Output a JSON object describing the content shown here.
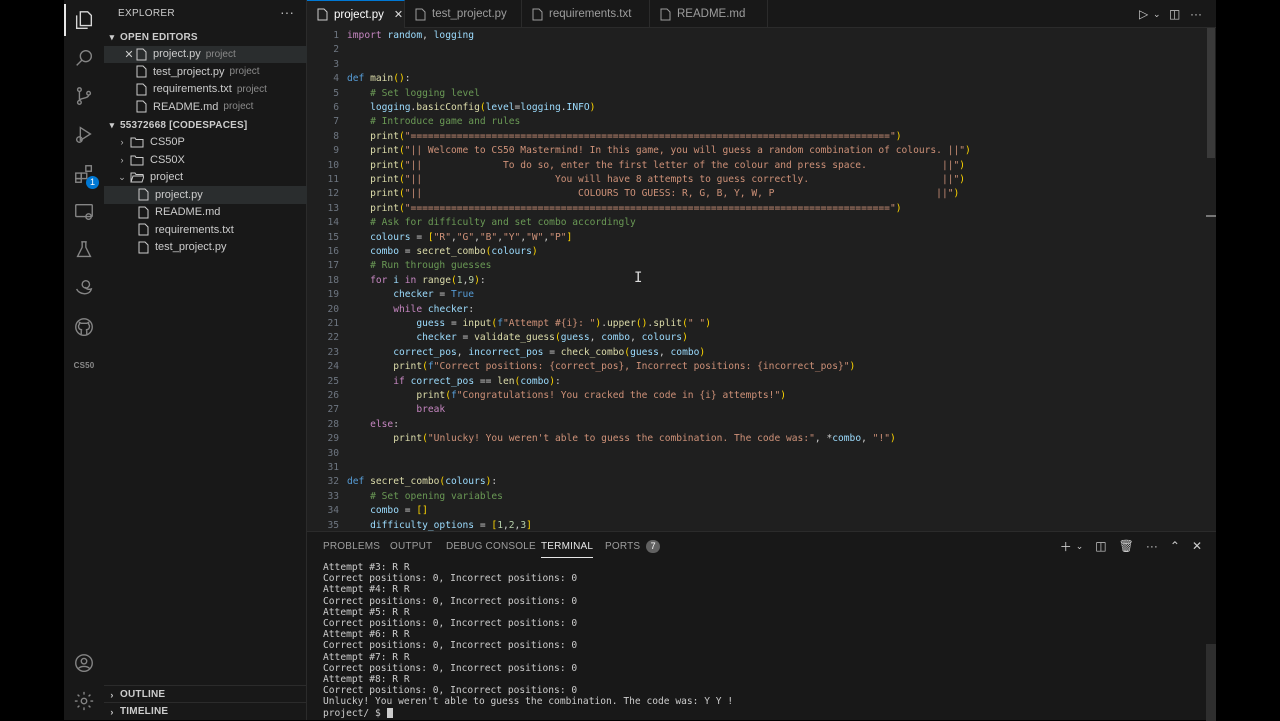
{
  "activity_bar": {
    "extensions_badge": "1",
    "cs50_label": "CS50"
  },
  "explorer": {
    "title": "EXPLORER",
    "open_editors_label": "OPEN EDITORS",
    "open_editors": [
      {
        "name": "project.py",
        "desc": "project"
      },
      {
        "name": "test_project.py",
        "desc": "project"
      },
      {
        "name": "requirements.txt",
        "desc": "project"
      },
      {
        "name": "README.md",
        "desc": "project"
      }
    ],
    "workspace_label": "55372668 [CODESPACES]",
    "folders": [
      "CS50P",
      "CS50X",
      "project"
    ],
    "project_files": [
      "project.py",
      "README.md",
      "requirements.txt",
      "test_project.py"
    ],
    "outline_label": "OUTLINE",
    "timeline_label": "TIMELINE"
  },
  "tabs": [
    {
      "label": "project.py"
    },
    {
      "label": "test_project.py"
    },
    {
      "label": "requirements.txt"
    },
    {
      "label": "README.md"
    }
  ],
  "editor": {
    "line_numbers": [
      "1",
      "2",
      "3",
      "4",
      "5",
      "6",
      "7",
      "8",
      "9",
      "10",
      "11",
      "12",
      "13",
      "14",
      "15",
      "16",
      "17",
      "18",
      "19",
      "20",
      "21",
      "22",
      "23",
      "24",
      "25",
      "26",
      "27",
      "28",
      "29",
      "30",
      "31",
      "32",
      "33",
      "34",
      "35"
    ],
    "code_lines": [
      "import random, logging",
      "",
      "",
      "def main():",
      "    # Set logging level",
      "    logging.basicConfig(level=logging.INFO)",
      "    # Introduce game and rules",
      "    print(\"===================================================================================\")",
      "    print(\"|| Welcome to CS50 Mastermind! In this game, you will guess a random combination of colours. ||\")",
      "    print(\"||              To do so, enter the first letter of the colour and press space.             ||\")",
      "    print(\"||                       You will have 8 attempts to guess correctly.                       ||\")",
      "    print(\"||                           COLOURS TO GUESS: R, G, B, Y, W, P                            ||\")",
      "    print(\"===================================================================================\")",
      "    # Ask for difficulty and set combo accordingly",
      "    colours = [\"R\",\"G\",\"B\",\"Y\",\"W\",\"P\"]",
      "    combo = secret_combo(colours)",
      "    # Run through guesses",
      "    for i in range(1,9):",
      "        checker = True",
      "        while checker:",
      "            guess = input(f\"Attempt #{i}: \").upper().split(\" \")",
      "            checker = validate_guess(guess, combo, colours)",
      "        correct_pos, incorrect_pos = check_combo(guess, combo)",
      "        print(f\"Correct positions: {correct_pos}, Incorrect positions: {incorrect_pos}\")",
      "        if correct_pos == len(combo):",
      "            print(f\"Congratulations! You cracked the code in {i} attempts!\")",
      "            break",
      "    else:",
      "        print(\"Unlucky! You weren't able to guess the combination. The code was:\", *combo, \"!\")",
      "",
      "",
      "def secret_combo(colours):",
      "    # Set opening variables",
      "    combo = []",
      "    difficulty_options = [1,2,3]"
    ]
  },
  "panel": {
    "tabs": [
      "PROBLEMS",
      "OUTPUT",
      "DEBUG CONSOLE",
      "TERMINAL",
      "PORTS"
    ],
    "ports_badge": "7",
    "terminal_lines": [
      "Attempt #3: R R",
      "Correct positions: 0, Incorrect positions: 0",
      "Attempt #4: R R",
      "Correct positions: 0, Incorrect positions: 0",
      "Attempt #5: R R",
      "Correct positions: 0, Incorrect positions: 0",
      "Attempt #6: R R",
      "Correct positions: 0, Incorrect positions: 0",
      "Attempt #7: R R",
      "Correct positions: 0, Incorrect positions: 0",
      "Attempt #8: R R",
      "Correct positions: 0, Incorrect positions: 0",
      "Unlucky! You weren't able to guess the combination. The code was: Y Y !"
    ],
    "prompt": "project/ $ "
  },
  "colors": {
    "accent": "#0078d4",
    "editor_bg": "#1f1f1f",
    "sidebar_bg": "#181818"
  }
}
